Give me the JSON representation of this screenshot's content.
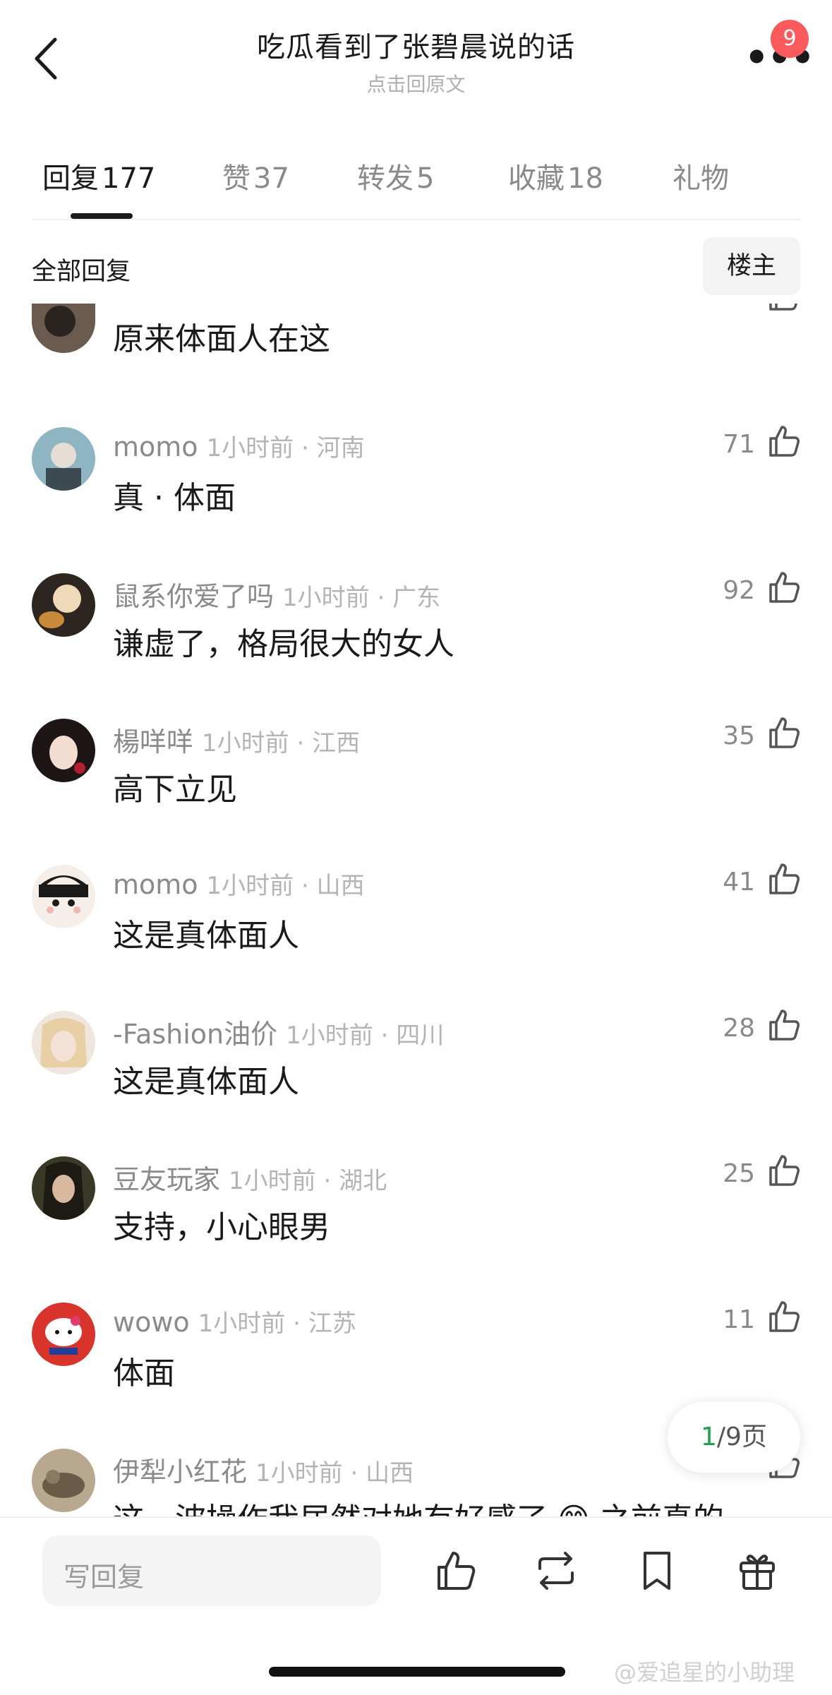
{
  "header": {
    "title": "吃瓜看到了张碧晨说的话",
    "subtitle": "点击回原文",
    "badge_count": "9",
    "more_label": "•••"
  },
  "tabs": [
    {
      "label": "回复",
      "count": "177"
    },
    {
      "label": "赞",
      "count": "37"
    },
    {
      "label": "转发",
      "count": "5"
    },
    {
      "label": "收藏",
      "count": "18"
    },
    {
      "label": "礼物",
      "count": ""
    }
  ],
  "filter": {
    "label": "全部回复",
    "op_button": "楼主"
  },
  "comments": [
    {
      "name": "",
      "time": "",
      "text": "原来体面人在这",
      "likes": "",
      "avatar_color": "#6b5b4e"
    },
    {
      "name": "momo",
      "time": "1小时前 · 河南",
      "text": "真 · 体面",
      "likes": "71",
      "avatar_color": "#7aa3b3"
    },
    {
      "name": "鼠系你爱了吗",
      "time": "1小时前 · 广东",
      "text": "谦虚了，格局很大的女人",
      "likes": "92",
      "avatar_color": "#3a3028"
    },
    {
      "name": "楊咩咩",
      "time": "1小时前 · 江西",
      "text": "高下立见",
      "likes": "35",
      "avatar_color": "#2b2020"
    },
    {
      "name": "momo",
      "time": "1小时前 · 山西",
      "text": "这是真体面人",
      "likes": "41",
      "avatar_color": "#f0e0d8"
    },
    {
      "name": "-Fashion油价",
      "time": "1小时前 · 四川",
      "text": "这是真体面人",
      "likes": "28",
      "avatar_color": "#e8d6c6"
    },
    {
      "name": "豆友玩家",
      "time": "1小时前 · 湖北",
      "text": "支持，小心眼男",
      "likes": "25",
      "avatar_color": "#3b3a2a"
    },
    {
      "name": "wowo",
      "time": "1小时前 · 江苏",
      "text": "体面",
      "likes": "11",
      "avatar_color": "#d9342b"
    },
    {
      "name": "伊犁小红花",
      "time": "1小时前 · 山西",
      "text": "这一波操作我居然对她有好感了 😊 之前真的",
      "likes": "",
      "avatar_color": "#8a7a6a"
    }
  ],
  "pagination": {
    "current": "1",
    "total": "/9页"
  },
  "bottom_bar": {
    "reply_placeholder": "写回复"
  },
  "watermark": "@爱追星的小助理"
}
